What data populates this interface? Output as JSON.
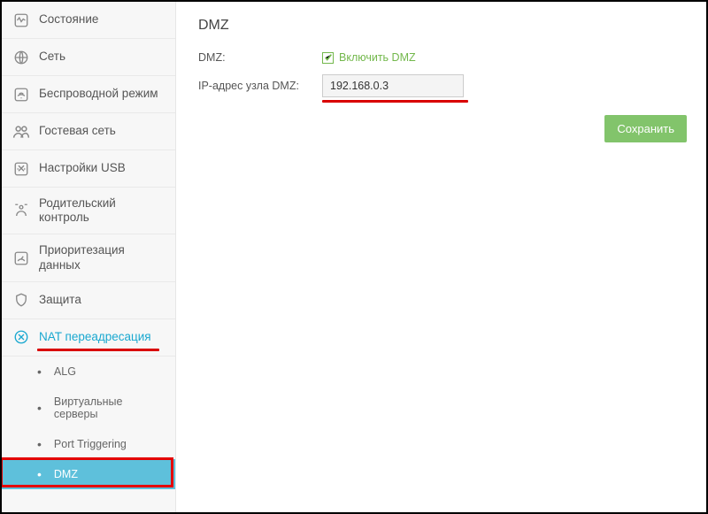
{
  "sidebar": {
    "items": [
      {
        "label": "Состояние",
        "icon": "activity"
      },
      {
        "label": "Сеть",
        "icon": "globe"
      },
      {
        "label": "Беспроводной режим",
        "icon": "wifi"
      },
      {
        "label": "Гостевая сеть",
        "icon": "users"
      },
      {
        "label": "Настройки USB",
        "icon": "usb"
      },
      {
        "label": "Родительский контроль",
        "icon": "shield"
      },
      {
        "label": "Приоритезация данных",
        "icon": "speed"
      },
      {
        "label": "Защита",
        "icon": "lock"
      },
      {
        "label": "NAT переадресация",
        "icon": "nat"
      }
    ],
    "submenu": [
      {
        "label": "ALG"
      },
      {
        "label": "Виртуальные серверы"
      },
      {
        "label": "Port Triggering"
      },
      {
        "label": "DMZ"
      }
    ]
  },
  "page": {
    "title": "DMZ",
    "dmz_label": "DMZ:",
    "enable_label": "Включить DMZ",
    "ip_label": "IP-адрес узла DMZ:",
    "ip_value": "192.168.0.3",
    "save_label": "Сохранить"
  }
}
